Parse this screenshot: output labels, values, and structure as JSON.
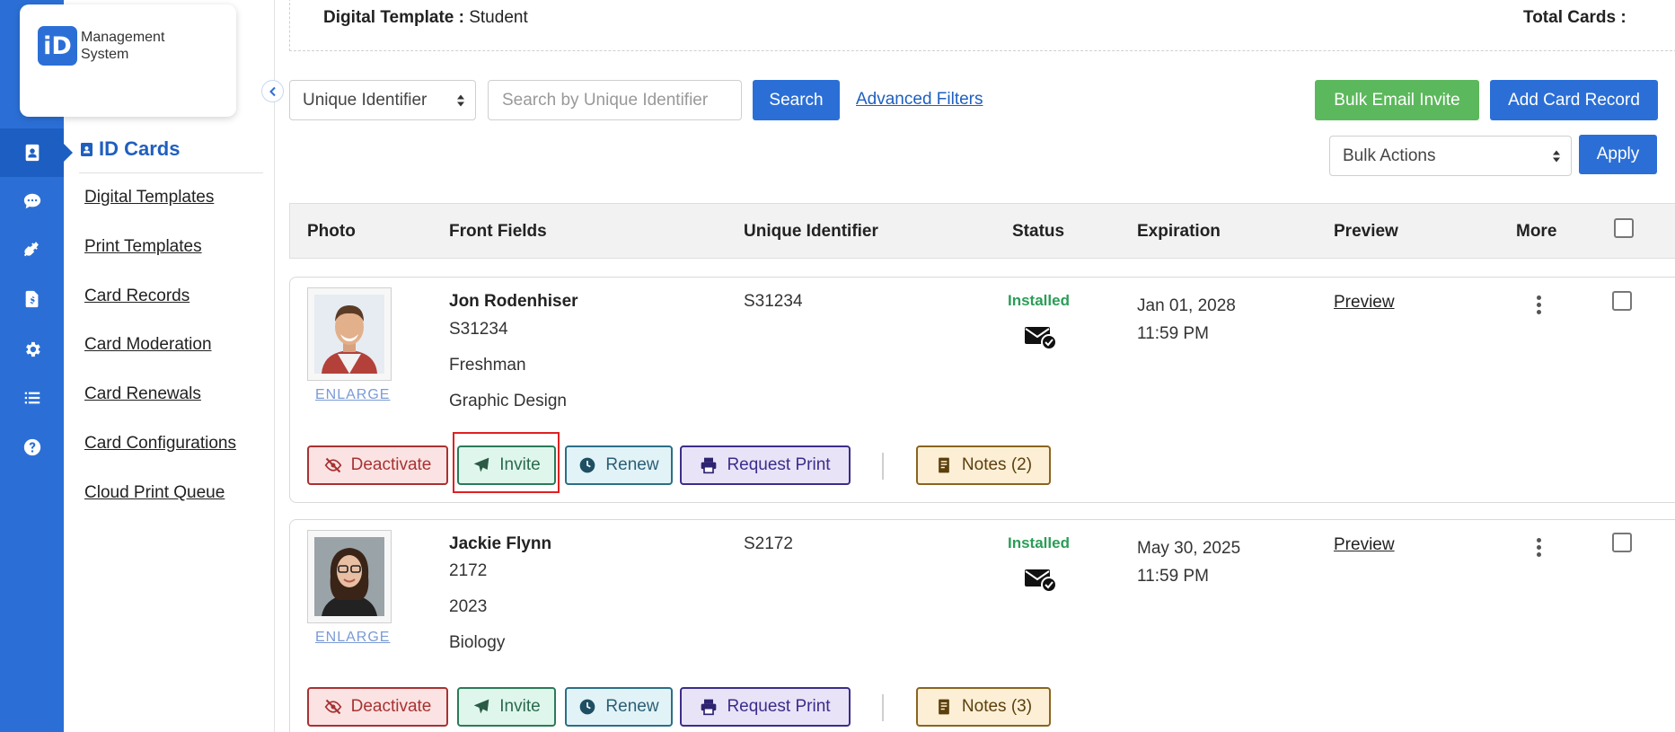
{
  "app": {
    "logo_mark": "iD",
    "logo_line1": "Management",
    "logo_line2": "System"
  },
  "rail": {
    "items": [
      {
        "icon": "id-card-icon",
        "active": true
      },
      {
        "icon": "chat-icon",
        "active": false
      },
      {
        "icon": "plug-icon",
        "active": false
      },
      {
        "icon": "invoice-icon",
        "active": false
      },
      {
        "icon": "gear-icon",
        "active": false
      },
      {
        "icon": "list-icon",
        "active": false
      },
      {
        "icon": "help-icon",
        "active": false
      }
    ]
  },
  "sidebar": {
    "title": "ID Cards",
    "items": [
      {
        "label": "Digital Templates"
      },
      {
        "label": "Print Templates"
      },
      {
        "label": "Card Records"
      },
      {
        "label": "Card Moderation"
      },
      {
        "label": "Card Renewals"
      },
      {
        "label": "Card Configurations"
      },
      {
        "label": "Cloud Print Queue"
      }
    ]
  },
  "template_bar": {
    "label": "Digital Template :",
    "value": "Student",
    "total_label": "Total Cards :"
  },
  "filters": {
    "identifier_select": "Unique Identifier",
    "search_placeholder": "Search by Unique Identifier",
    "search_button": "Search",
    "advanced_link": "Advanced Filters",
    "bulk_email_button": "Bulk Email Invite",
    "add_card_button": "Add Card Record",
    "bulk_actions_select": "Bulk Actions",
    "apply_button": "Apply"
  },
  "table": {
    "headers": [
      "Photo",
      "Front Fields",
      "Unique Identifier",
      "Status",
      "Expiration",
      "Preview",
      "More"
    ],
    "enlarge_label": "ENLARGE",
    "preview_label": "Preview",
    "actions": {
      "deactivate": "Deactivate",
      "invite": "Invite",
      "renew": "Renew",
      "request_print": "Request Print"
    },
    "rows": [
      {
        "name": "Jon Rodenhiser",
        "fields": [
          "S31234",
          "Freshman",
          "Graphic Design"
        ],
        "unique_id": "S31234",
        "status": "Installed",
        "exp_date": "Jan 01, 2028",
        "exp_time": "11:59 PM",
        "notes": "Notes (2)"
      },
      {
        "name": "Jackie Flynn",
        "fields": [
          "2172",
          "2023",
          "Biology"
        ],
        "unique_id": "S2172",
        "status": "Installed",
        "exp_date": "May 30, 2025",
        "exp_time": "11:59 PM",
        "notes": "Notes (3)"
      }
    ]
  },
  "colors": {
    "brand": "#2b6fd6",
    "installed": "#2a9d57",
    "bulk_email": "#5cb85c"
  }
}
